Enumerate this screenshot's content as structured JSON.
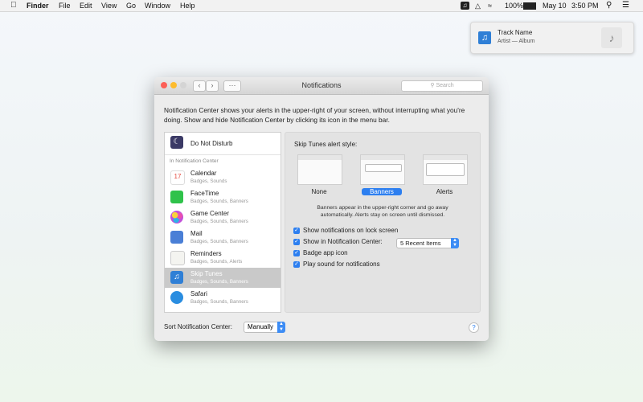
{
  "menubar": {
    "apple": "",
    "app": "Finder",
    "menus": [
      "File",
      "Edit",
      "View",
      "Go",
      "Window",
      "Help"
    ],
    "battery": "100%",
    "date": "May 10",
    "time": "3:50 PM"
  },
  "notification": {
    "title": "Track Name",
    "subtitle": "Artist — Album"
  },
  "window": {
    "title": "Notifications",
    "search_placeholder": "Search",
    "description": "Notification Center shows your alerts in the upper-right of your screen, without interrupting what you're doing. Show and hide Notification Center by clicking its icon in the menu bar.",
    "dnd": "Do Not Disturb",
    "section": "In Notification Center",
    "apps": [
      {
        "name": "Calendar",
        "sub": "Badges, Sounds",
        "color": "#e44a3f"
      },
      {
        "name": "FaceTime",
        "sub": "Badges, Sounds, Banners",
        "color": "#2fc24a"
      },
      {
        "name": "Game Center",
        "sub": "Badges, Sounds, Banners",
        "color": "#c24fd9"
      },
      {
        "name": "Mail",
        "sub": "Badges, Sounds, Banners",
        "color": "#4a7fd6"
      },
      {
        "name": "Reminders",
        "sub": "Badges, Sounds, Alerts",
        "color": "#9aa39a"
      },
      {
        "name": "Skip Tunes",
        "sub": "Badges, Sounds, Banners",
        "color": "#2f7fd6"
      },
      {
        "name": "Safari",
        "sub": "Badges, Sounds, Banners",
        "color": "#2a8de0"
      }
    ],
    "alert_style_label": "Skip Tunes alert style:",
    "styles": [
      "None",
      "Banners",
      "Alerts"
    ],
    "explain": "Banners appear in the upper-right corner and go away automatically. Alerts stay on screen until dismissed.",
    "checkboxes": [
      "Show notifications on lock screen",
      "Show in Notification Center:",
      "Badge app icon",
      "Play sound for notifications"
    ],
    "recent_items": "5 Recent Items",
    "sort_label": "Sort Notification Center:",
    "sort_value": "Manually",
    "help": "?"
  }
}
